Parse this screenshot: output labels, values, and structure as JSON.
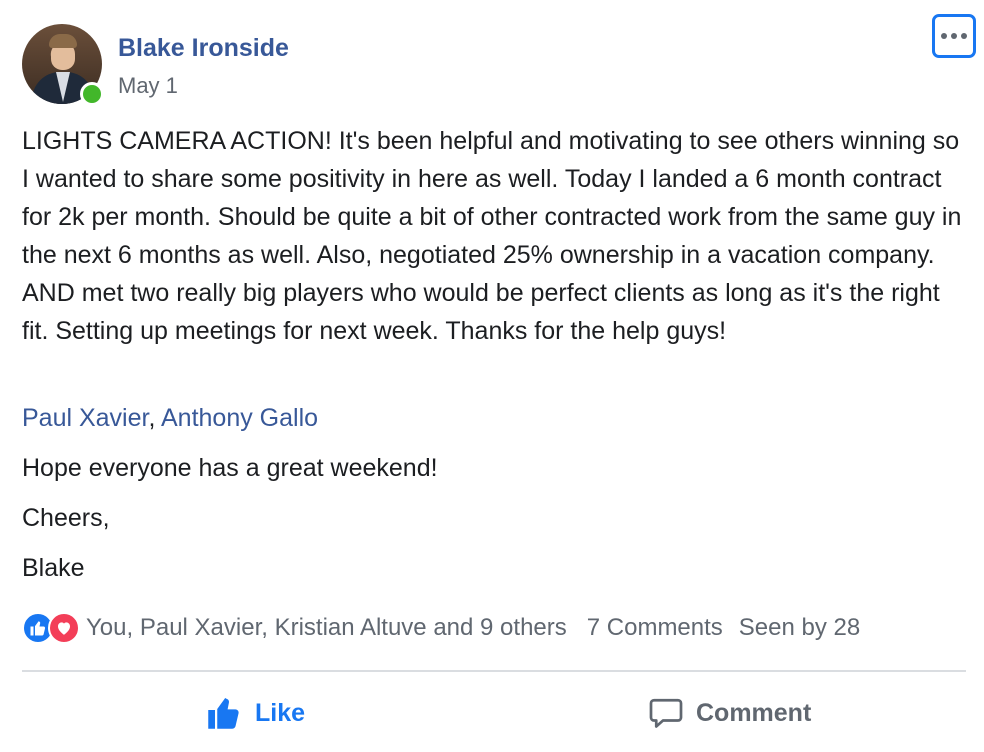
{
  "author": {
    "name": "Blake Ironside",
    "date": "May 1"
  },
  "post": {
    "text": "LIGHTS CAMERA ACTION! It's been helpful and motivating to see others winning so I wanted to share some positivity in here as well. Today I landed a 6 month contract for 2k per month. Should be quite a bit of other contracted work from the same guy in the next 6 months as well. Also, negotiated 25% ownership in a vacation company. AND met two really big players who would be perfect clients as long as it's the right fit. Setting up meetings for next week. Thanks for the help guys!",
    "tags": [
      "Paul Xavier",
      "Anthony Gallo"
    ],
    "tag_separator": ", ",
    "line1": "Hope everyone has a great weekend!",
    "line2": "Cheers,",
    "line3": "Blake"
  },
  "stats": {
    "reactors": "You, Paul Xavier, Kristian Altuve and 9 others",
    "comments": "7 Comments",
    "seen_by": "Seen by 28"
  },
  "actions": {
    "like_label": "Like",
    "comment_label": "Comment"
  },
  "icons": {
    "reaction_like": "thumbs-up-icon",
    "reaction_love": "heart-icon",
    "more": "more-dots-icon",
    "like": "thumbs-up-icon",
    "comment": "speech-bubble-icon"
  },
  "colors": {
    "link": "#385898",
    "accent": "#1877f2",
    "love": "#f33e58",
    "online": "#42b72a",
    "muted": "#606770"
  }
}
